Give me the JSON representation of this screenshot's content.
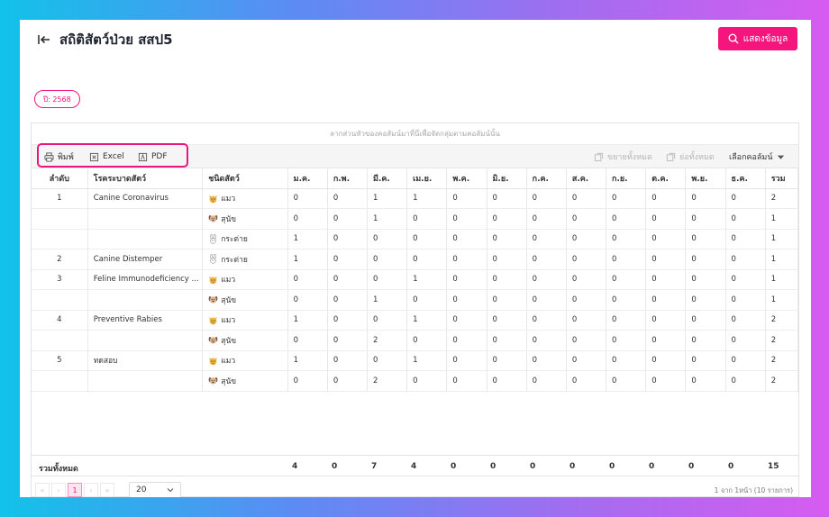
{
  "header": {
    "title": "สถิติสัตว์ป่วย สสป5",
    "show_button": "แสดงข้อมูล"
  },
  "filters": {
    "year_badge": "ปี: 2568"
  },
  "grid": {
    "group_panel_hint": "ลากส่วนหัวของคอลัมน์มาที่นี่เพื่อจัดกลุ่มตามคอลัมน์นั้น",
    "toolbar": {
      "print": "พิมพ์",
      "excel": "Excel",
      "pdf": "PDF",
      "expand_all": "ขยายทั้งหมด",
      "collapse_all": "ย่อทั้งหมด",
      "column_chooser": "เลือกคอลัมน์"
    },
    "columns": [
      "ลำดับ",
      "โรคระบาดสัตว์",
      "ชนิดสัตว์",
      "ม.ค.",
      "ก.พ.",
      "มี.ค.",
      "เม.ย.",
      "พ.ค.",
      "มิ.ย.",
      "ก.ค.",
      "ส.ค.",
      "ก.ย.",
      "ต.ค.",
      "พ.ย.",
      "ธ.ค.",
      "รวม"
    ],
    "rows": [
      {
        "no": "1",
        "disease": "Canine Coronavirus",
        "animal": "แมว",
        "icon": "cat-icon",
        "m": [
          "0",
          "0",
          "1",
          "1",
          "0",
          "0",
          "0",
          "0",
          "0",
          "0",
          "0",
          "0"
        ],
        "total": "2"
      },
      {
        "no": "",
        "disease": "",
        "animal": "สุนัข",
        "icon": "dog-icon",
        "m": [
          "0",
          "0",
          "1",
          "0",
          "0",
          "0",
          "0",
          "0",
          "0",
          "0",
          "0",
          "0"
        ],
        "total": "1"
      },
      {
        "no": "",
        "disease": "",
        "animal": "กระต่าย",
        "icon": "rabbit-icon",
        "m": [
          "1",
          "0",
          "0",
          "0",
          "0",
          "0",
          "0",
          "0",
          "0",
          "0",
          "0",
          "0"
        ],
        "total": "1"
      },
      {
        "no": "2",
        "disease": "Canine Distemper",
        "animal": "กระต่าย",
        "icon": "rabbit-icon",
        "m": [
          "1",
          "0",
          "0",
          "0",
          "0",
          "0",
          "0",
          "0",
          "0",
          "0",
          "0",
          "0"
        ],
        "total": "1"
      },
      {
        "no": "3",
        "disease": "Feline Immunodeficiency ...",
        "animal": "แมว",
        "icon": "cat-icon",
        "m": [
          "0",
          "0",
          "0",
          "1",
          "0",
          "0",
          "0",
          "0",
          "0",
          "0",
          "0",
          "0"
        ],
        "total": "1"
      },
      {
        "no": "",
        "disease": "",
        "animal": "สุนัข",
        "icon": "dog-icon",
        "m": [
          "0",
          "0",
          "1",
          "0",
          "0",
          "0",
          "0",
          "0",
          "0",
          "0",
          "0",
          "0"
        ],
        "total": "1"
      },
      {
        "no": "4",
        "disease": "Preventive Rabies",
        "animal": "แมว",
        "icon": "cat-icon",
        "m": [
          "1",
          "0",
          "0",
          "1",
          "0",
          "0",
          "0",
          "0",
          "0",
          "0",
          "0",
          "0"
        ],
        "total": "2"
      },
      {
        "no": "",
        "disease": "",
        "animal": "สุนัข",
        "icon": "dog-icon",
        "m": [
          "0",
          "0",
          "2",
          "0",
          "0",
          "0",
          "0",
          "0",
          "0",
          "0",
          "0",
          "0"
        ],
        "total": "2"
      },
      {
        "no": "5",
        "disease": "ทดสอบ",
        "animal": "แมว",
        "icon": "cat-icon",
        "m": [
          "1",
          "0",
          "0",
          "1",
          "0",
          "0",
          "0",
          "0",
          "0",
          "0",
          "0",
          "0"
        ],
        "total": "2"
      },
      {
        "no": "",
        "disease": "",
        "animal": "สุนัข",
        "icon": "dog-icon",
        "m": [
          "0",
          "0",
          "2",
          "0",
          "0",
          "0",
          "0",
          "0",
          "0",
          "0",
          "0",
          "0"
        ],
        "total": "2"
      }
    ],
    "summary": {
      "label": "รวมทั้งหมด",
      "values": [
        "4",
        "0",
        "7",
        "4",
        "0",
        "0",
        "0",
        "0",
        "0",
        "0",
        "0",
        "0"
      ],
      "total": "15"
    }
  },
  "pager": {
    "first": "«",
    "prev": "‹",
    "current_page": "1",
    "next": "›",
    "last": "»",
    "page_size": "20",
    "info": "1 จาก 1หน้า (10 รายการ)"
  },
  "colors": {
    "accent": "#f4157d",
    "highlight_border": "#e8177f"
  }
}
